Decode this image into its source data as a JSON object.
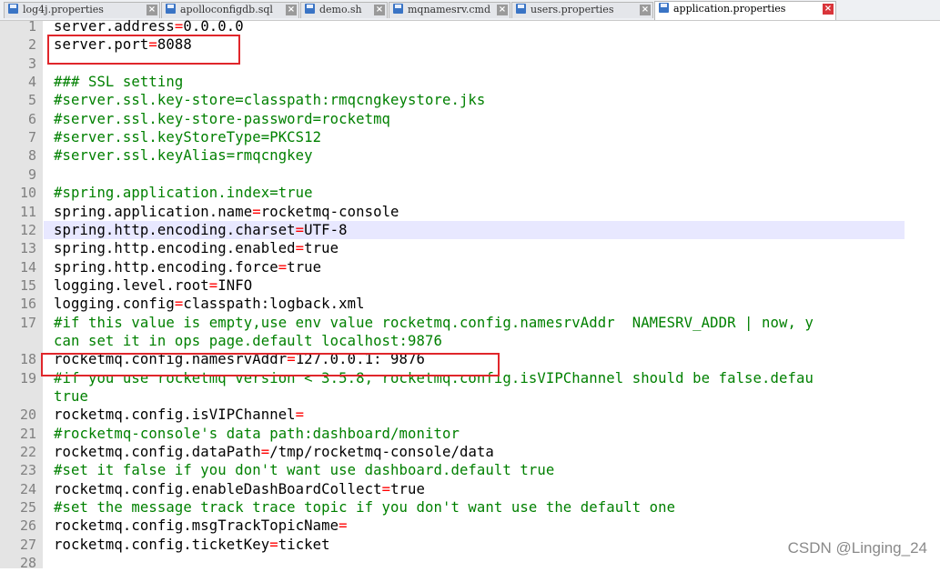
{
  "tabs": [
    {
      "label": "log4j.properties",
      "active": false
    },
    {
      "label": "apolloconfigdb.sql",
      "active": false
    },
    {
      "label": "demo.sh",
      "active": false
    },
    {
      "label": "mqnamesrv.cmd",
      "active": false
    },
    {
      "label": "users.properties",
      "active": false
    },
    {
      "label": "application.properties",
      "active": true
    }
  ],
  "close_glyph": "×",
  "lines": [
    {
      "n": "1",
      "segs": [
        [
          "k",
          "server.address"
        ],
        [
          "op",
          "="
        ],
        [
          "k",
          "0.0.0.0"
        ]
      ]
    },
    {
      "n": "2",
      "segs": [
        [
          "k",
          "server.port"
        ],
        [
          "op",
          "="
        ],
        [
          "k",
          "8088"
        ]
      ]
    },
    {
      "n": "3",
      "segs": []
    },
    {
      "n": "4",
      "segs": [
        [
          "cm",
          "### SSL setting"
        ]
      ]
    },
    {
      "n": "5",
      "segs": [
        [
          "cm",
          "#server.ssl.key-store=classpath:rmqcngkeystore.jks"
        ]
      ]
    },
    {
      "n": "6",
      "segs": [
        [
          "cm",
          "#server.ssl.key-store-password=rocketmq"
        ]
      ]
    },
    {
      "n": "7",
      "segs": [
        [
          "cm",
          "#server.ssl.keyStoreType=PKCS12"
        ]
      ]
    },
    {
      "n": "8",
      "segs": [
        [
          "cm",
          "#server.ssl.keyAlias=rmqcngkey"
        ]
      ]
    },
    {
      "n": "9",
      "segs": []
    },
    {
      "n": "10",
      "segs": [
        [
          "cm",
          "#spring.application.index=true"
        ]
      ]
    },
    {
      "n": "11",
      "segs": [
        [
          "k",
          "spring.application.name"
        ],
        [
          "op",
          "="
        ],
        [
          "k",
          "rocketmq-console"
        ]
      ]
    },
    {
      "n": "12",
      "segs": [
        [
          "k",
          "spring.http.encoding.charset"
        ],
        [
          "op",
          "="
        ],
        [
          "k",
          "UTF-8"
        ]
      ],
      "highlight": true
    },
    {
      "n": "13",
      "segs": [
        [
          "k",
          "spring.http.encoding.enabled"
        ],
        [
          "op",
          "="
        ],
        [
          "k",
          "true"
        ]
      ]
    },
    {
      "n": "14",
      "segs": [
        [
          "k",
          "spring.http.encoding.force"
        ],
        [
          "op",
          "="
        ],
        [
          "k",
          "true"
        ]
      ]
    },
    {
      "n": "15",
      "segs": [
        [
          "k",
          "logging.level.root"
        ],
        [
          "op",
          "="
        ],
        [
          "k",
          "INFO"
        ]
      ]
    },
    {
      "n": "16",
      "segs": [
        [
          "k",
          "logging.config"
        ],
        [
          "op",
          "="
        ],
        [
          "k",
          "classpath:logback.xml"
        ]
      ]
    },
    {
      "n": "17",
      "segs": [
        [
          "cm",
          "#if this value is empty,use env value rocketmq.config.namesrvAddr  NAMESRV_ADDR | now, y"
        ]
      ]
    },
    {
      "n": "",
      "segs": [
        [
          "cm",
          "can set it in ops page.default localhost:9876"
        ]
      ]
    },
    {
      "n": "18",
      "segs": [
        [
          "k",
          "rocketmq.config.namesrvAddr"
        ],
        [
          "op",
          "="
        ],
        [
          "k",
          "127.0.0.1: 9876"
        ]
      ]
    },
    {
      "n": "19",
      "segs": [
        [
          "cm",
          "#if you use rocketmq version < 3.5.8, rocketmq.config.isVIPChannel should be false.defau"
        ]
      ]
    },
    {
      "n": "",
      "segs": [
        [
          "cm",
          "true"
        ]
      ]
    },
    {
      "n": "20",
      "segs": [
        [
          "k",
          "rocketmq.config.isVIPChannel"
        ],
        [
          "op",
          "="
        ]
      ]
    },
    {
      "n": "21",
      "segs": [
        [
          "cm",
          "#rocketmq-console's data path:dashboard/monitor"
        ]
      ]
    },
    {
      "n": "22",
      "segs": [
        [
          "k",
          "rocketmq.config.dataPath"
        ],
        [
          "op",
          "="
        ],
        [
          "k",
          "/tmp/rocketmq-console/data"
        ]
      ]
    },
    {
      "n": "23",
      "segs": [
        [
          "cm",
          "#set it false if you don't want use dashboard.default true"
        ]
      ]
    },
    {
      "n": "24",
      "segs": [
        [
          "k",
          "rocketmq.config.enableDashBoardCollect"
        ],
        [
          "op",
          "="
        ],
        [
          "k",
          "true"
        ]
      ]
    },
    {
      "n": "25",
      "segs": [
        [
          "cm",
          "#set the message track trace topic if you don't want use the default one"
        ]
      ]
    },
    {
      "n": "26",
      "segs": [
        [
          "k",
          "rocketmq.config.msgTrackTopicName"
        ],
        [
          "op",
          "="
        ]
      ]
    },
    {
      "n": "27",
      "segs": [
        [
          "k",
          "rocketmq.config.ticketKey"
        ],
        [
          "op",
          "="
        ],
        [
          "k",
          "ticket"
        ]
      ]
    },
    {
      "n": "28",
      "segs": []
    }
  ],
  "watermark": "CSDN @Linging_24",
  "colors": {
    "operator": "#ff0000",
    "comment": "#008000",
    "annotation_box": "#e0262b",
    "current_line": "#e8e8ff"
  }
}
